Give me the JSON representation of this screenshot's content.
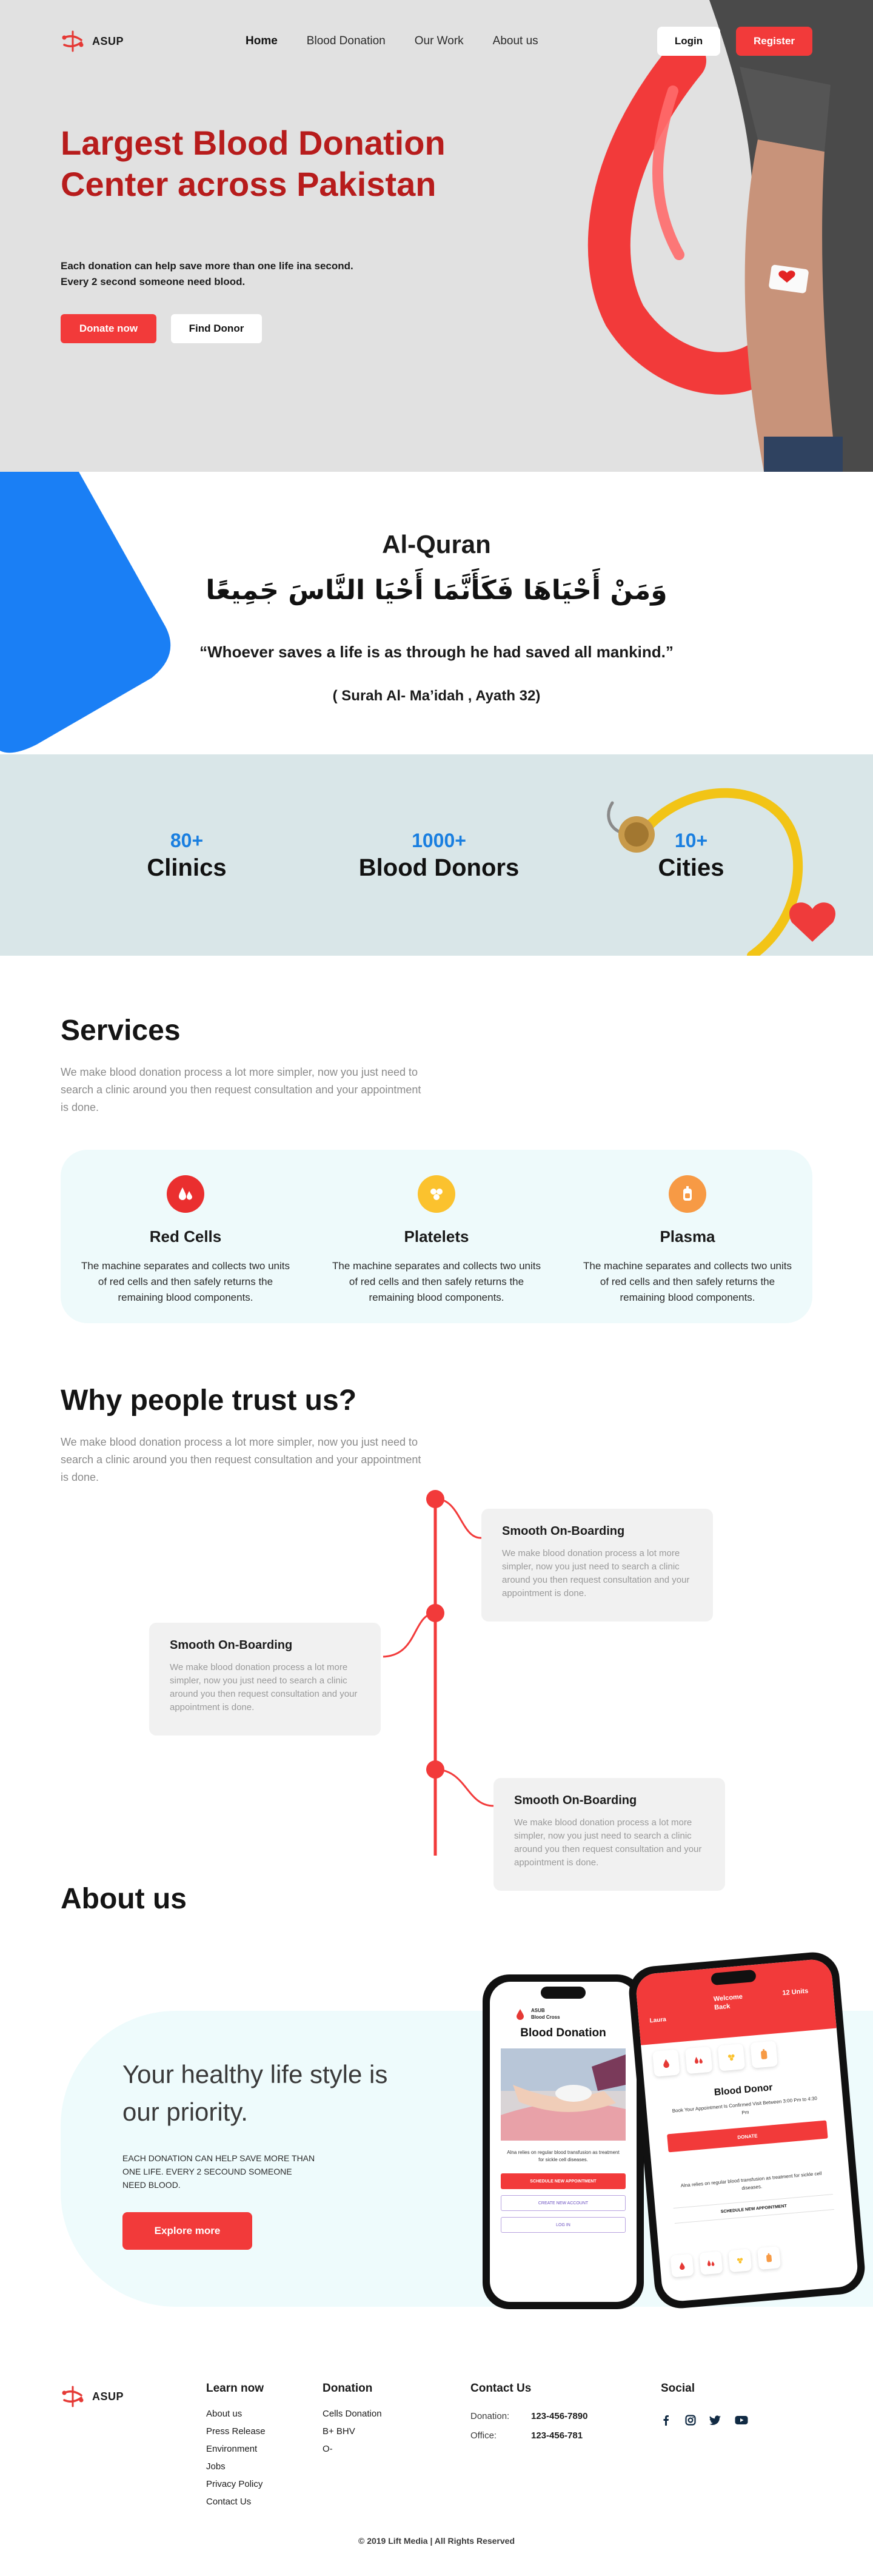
{
  "brand": {
    "name": "ASUP"
  },
  "nav": {
    "links": [
      "Home",
      "Blood Donation",
      "Our Work",
      "About us"
    ],
    "login": "Login",
    "register": "Register"
  },
  "hero": {
    "title": "Largest Blood Donation Center across Pakistan",
    "subtitle_line1": "Each donation can help save more than one life ina second.",
    "subtitle_line2": "Every 2 second someone need blood.",
    "donate_btn": "Donate now",
    "find_btn": "Find Donor"
  },
  "quran": {
    "title": "Al-Quran",
    "arabic": "وَمَنْ أَحْيَاهَا فَكَأَنَّمَا أَحْيَا النَّاسَ جَمِيعًا",
    "quote": "“Whoever saves a life is as through he had saved all mankind.”",
    "reference": "( Surah Al- Ma’idah , Ayath 32)"
  },
  "stats": [
    {
      "number": "80+",
      "label": "Clinics"
    },
    {
      "number": "1000+",
      "label": "Blood Donors"
    },
    {
      "number": "10+",
      "label": "Cities"
    }
  ],
  "services": {
    "title": "Services",
    "description": "We make blood donation process a lot more simpler, now you just need to search a clinic around you then request consultation and your appointment is done.",
    "items": [
      {
        "name": "Red Cells",
        "description": "The machine separates and collects two units of red cells and then safely returns the remaining blood components.",
        "color": "#ea2f2f",
        "icon": "blood-drops-icon"
      },
      {
        "name": "Platelets",
        "description": "The machine separates and collects two units of red cells and then safely returns the remaining blood components.",
        "color": "#fbc22e",
        "icon": "platelets-icon"
      },
      {
        "name": "Plasma",
        "description": "The machine separates and collects two units of red cells and then safely returns the remaining blood components.",
        "color": "#f79a45",
        "icon": "plasma-bag-icon"
      }
    ]
  },
  "trust": {
    "title": "Why people trust us?",
    "description": "We make blood donation process a lot more simpler, now you just need to search a clinic around you then request consultation and your appointment is done.",
    "cards": [
      {
        "title": "Smooth On-Boarding",
        "description": "We make blood donation process a lot more simpler, now you just need to search a clinic around you then request consultation and your appointment is done."
      },
      {
        "title": "Smooth On-Boarding",
        "description": "We make blood donation process a lot more simpler, now you just need to search a clinic around you then request consultation and your appointment is done."
      },
      {
        "title": "Smooth On-Boarding",
        "description": "We make blood donation process a lot more simpler, now you just need to search a clinic around you then request consultation and your appointment is done."
      }
    ]
  },
  "about": {
    "title": "About us",
    "heading": "Your healthy life style is our priority.",
    "text": "Each donation can help save more than one life. Every 2 secound someone need blood.",
    "explore_btn": "Explore more",
    "phone1": {
      "org_line1": "ASUB",
      "org_line2": "Blood Cross",
      "heading": "Blood Donation",
      "caption": "Alna relies on regular blood transfusion as treatment for sickle cell diseases.",
      "btn1": "SCHEDULE NEW APPOINTMENT",
      "btn2": "CREATE NEW ACCOUNT",
      "btn3": "LOG IN"
    },
    "phone2": {
      "user": "Laura",
      "welcome": "Welcome Back",
      "units": "12 Units",
      "card_title": "Blood Donor",
      "card_text": "Book Your Appointment Is Confirmed Visit Between 3:00 Pm to 4:30 Pm",
      "donate": "DONATE",
      "caption": "Alna relies on regular blood transfusion as treatment for sickle cell diseases.",
      "schedule": "SCHEDULE NEW APPOINTMENT"
    }
  },
  "footer": {
    "learn_title": "Learn now",
    "learn_links": [
      "About us",
      "Press Release",
      "Environment",
      "Jobs",
      "Privacy Policy",
      "Contact Us"
    ],
    "donation_title": "Donation",
    "donation_links": [
      "Cells Donation",
      "B+ BHV",
      "O-"
    ],
    "contact_title": "Contact Us",
    "contacts": [
      {
        "label": "Donation:",
        "value": "123-456-7890"
      },
      {
        "label": "Office:",
        "value": "123-456-781"
      }
    ],
    "social_title": "Social",
    "copyright": "© 2019 Lift Media | All Rights Reserved"
  },
  "colors": {
    "brand_red": "#f23a3a",
    "dark_red": "#b71c1c",
    "accent_blue": "#1a7fe0",
    "light_cyan": "#eefafb"
  }
}
